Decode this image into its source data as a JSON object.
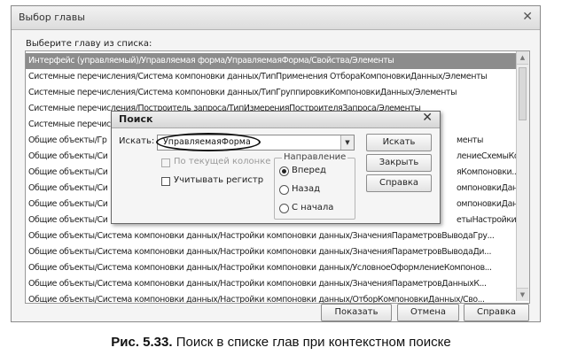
{
  "window": {
    "title": "Выбор главы",
    "close_glyph": "✕",
    "prompt": "Выберите главу из списка:"
  },
  "chapter_list": {
    "selected_index": 0,
    "items": [
      "Интерфейс (управляемый)/Управляемая форма/УправляемаяФорма/Свойства/Элементы",
      "Системные перечисления/Система компоновки данных/ТипПрименения ОтбораКомпоновкиДанных/Элементы",
      "Системные перечисления/Система компоновки данных/ТипГруппировкиКомпоновкиДанных/Элементы",
      "Системные перечисления/Построитель запроса/ТипИзмеренияПостроителяЗапроса/Элементы",
      "Системные перечис",
      "Общие объекты/Гр",
      "Общие объекты/Си",
      "Общие объекты/Си",
      "Общие объекты/Си",
      "Общие объекты/Си",
      "Общие объекты/Си",
      "Общие объекты/Система компоновки данных/Настройки компоновки данных/ЗначенияПараметровВыводаГру...",
      "Общие объекты/Система компоновки данных/Настройки компоновки данных/ЗначенияПараметровВыводаДи...",
      "Общие объекты/Система компоновки данных/Настройки компоновки данных/УсловноеОформлениеКомпонов...",
      "Общие объекты/Система компоновки данных/Настройки компоновки данных/ЗначенияПараметровДанныхК...",
      "Общие объекты/Система компоновки данных/Настройки компоновки данных/ОтборКомпоновкиДанных/Сво..."
    ],
    "right_fragments": [
      "",
      "",
      "",
      "",
      "",
      "менты",
      "лениеСхемыКо...",
      "яКомпоновки...",
      "омпоновкиДан...",
      "омпоновкиДан...",
      "етыНастройкиК..."
    ]
  },
  "footer_buttons": {
    "show": "Показать",
    "cancel": "Отмена",
    "help": "Справка"
  },
  "search_dialog": {
    "title": "Поиск",
    "close_glyph": "✕",
    "search_label": "Искать:",
    "search_value": "УправляемаяФорма",
    "current_column": "По текущей колонке",
    "match_case": "Учитывать регистр",
    "direction_legend": "Направление",
    "direction_options": [
      "Вперед",
      "Назад",
      "С начала"
    ],
    "direction_selected": 0,
    "find_button": "Искать",
    "close_button": "Закрыть",
    "help_button": "Справка"
  },
  "caption": {
    "number": "Рис. 5.33.",
    "text": "Поиск в списке глав при контекстном поиске"
  }
}
